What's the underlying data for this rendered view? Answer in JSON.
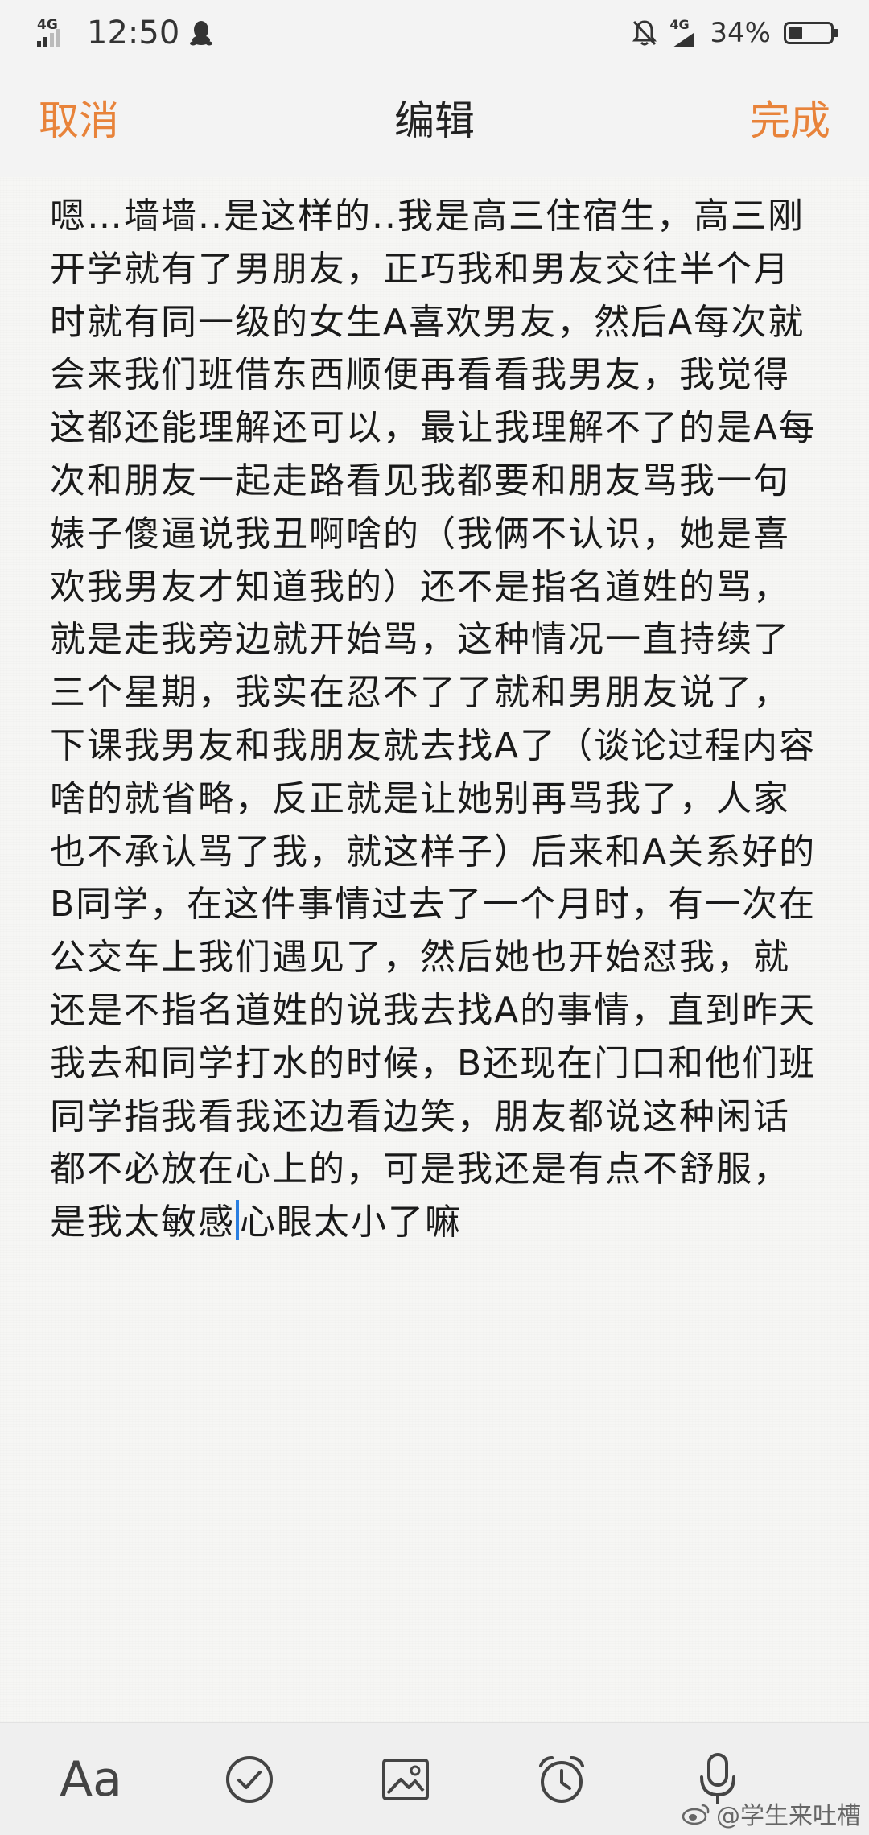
{
  "status_bar": {
    "left_network": "4G",
    "time": "12:50",
    "right_network": "4G",
    "battery_percent": "34%",
    "battery_level": 0.34,
    "icons": [
      "signal-icon",
      "qq-notification-icon",
      "mute-bell-icon",
      "network-icon",
      "battery-icon"
    ]
  },
  "nav": {
    "cancel_label": "取消",
    "title": "编辑",
    "done_label": "完成",
    "accent_color": "#e8833a"
  },
  "note": {
    "text_before_cursor": "嗯…墙墙..是这样的..我是高三住宿生，高三刚开学就有了男朋友，正巧我和男友交往半个月时就有同一级的女生A喜欢男友，然后A每次就会来我们班借东西顺便再看看我男友，我觉得这都还能理解还可以，最让我理解不了的是A每次和朋友一起走路看见我都要和朋友骂我一句婊子傻逼说我丑啊啥的（我俩不认识，她是喜欢我男友才知道我的）还不是指名道姓的骂，就是走我旁边就开始骂，这种情况一直持续了三个星期，我实在忍不了了就和男朋友说了，下课我男友和我朋友就去找A了（谈论过程内容啥的就省略，反正就是让她别再骂我了，人家也不承认骂了我，就这样子）后来和A关系好的B同学，在这件事情过去了一个月时，有一次在公交车上我们遇见了，然后她也开始怼我，就还是不指名道姓的说我去找A的事情，直到昨天我去和同学打水的时候，B还现在门口和他们班同学指我看我还边看边笑，朋友都说这种闲话都不必放在心上的，可是我还是有点不舒服，是我太敏感",
    "text_after_cursor": "心眼太小了嘛",
    "cursor_color": "#2a7fe0"
  },
  "toolbar": {
    "format_label": "Aa",
    "tools": [
      "format-text-icon",
      "checklist-icon",
      "image-icon",
      "alarm-icon",
      "microphone-icon"
    ]
  },
  "watermark": {
    "text": "@学生来吐槽"
  }
}
